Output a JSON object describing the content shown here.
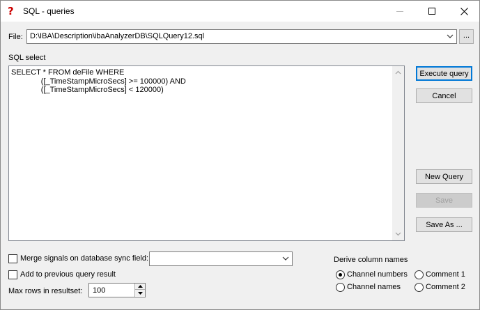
{
  "window": {
    "title": "SQL - queries",
    "app_icon_glyph": "?"
  },
  "file": {
    "label": "File:",
    "value": "D:\\IBA\\Description\\ibaAnalyzerDB\\SQLQuery12.sql",
    "browse_label": "..."
  },
  "sql": {
    "section_label": "SQL select",
    "text": "SELECT * FROM deFile WHERE\n              ([_TimeStampMicroSecs] >= 100000) AND\n              ([_TimeStampMicroSecs] < 120000)"
  },
  "buttons": {
    "execute": "Execute query",
    "cancel": "Cancel",
    "new_query": "New Query",
    "save": "Save",
    "save_as": "Save As ..."
  },
  "options": {
    "merge_label": "Merge signals on database sync field:",
    "merge_checked": false,
    "merge_field_value": "",
    "add_previous_label": "Add to previous query result",
    "add_previous_checked": false,
    "max_rows_label": "Max rows in resultset:",
    "max_rows_value": "100"
  },
  "derive": {
    "label": "Derive column names",
    "channel_numbers": "Channel numbers",
    "channel_names": "Channel names",
    "comment1": "Comment 1",
    "comment2": "Comment 2",
    "selected": "Channel numbers"
  },
  "colors": {
    "accent": "#0078d7",
    "app_icon": "#cc0000"
  }
}
